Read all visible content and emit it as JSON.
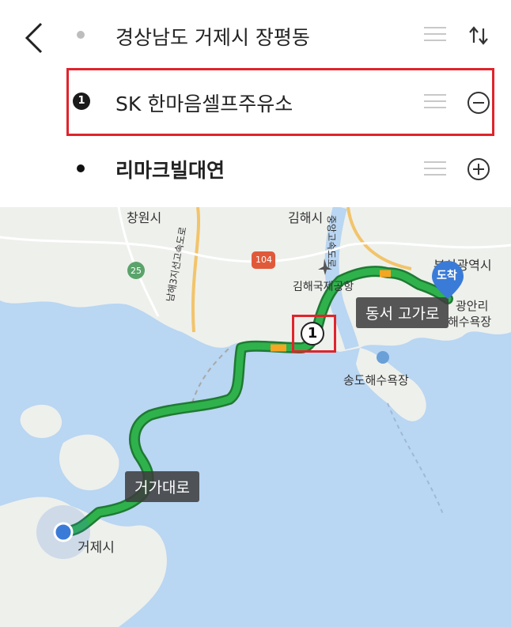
{
  "header": {
    "origin": {
      "label": "경상남도 거제시 장평동"
    },
    "waypoint": {
      "number": "1",
      "label": "SK 한마음셀프주유소"
    },
    "destination": {
      "label": "리마크빌대연"
    }
  },
  "map": {
    "labels": {
      "changwon": "창원시",
      "gimhae": "김해시",
      "busan_station": "부산광역시",
      "gimhae_airport": "김해국제공항",
      "songdo_beach": "송도해수욕장",
      "geoje": "거제시",
      "namhae_expressway": "남해3지선고속도로",
      "expressway_vertical": "중앙고속도로",
      "gwangan": "광안리",
      "haesu": "해수욕장",
      "route_104": "104",
      "route_25": "25"
    },
    "road_callouts": {
      "dongseo": "동서 고가로",
      "geoga": "거가대로"
    },
    "destination_pin": "도착",
    "waypoint_marker": "1"
  },
  "colors": {
    "route": "#2fb24c",
    "route_outline": "#1f7a33",
    "highlight": "#e0242c",
    "sea": "#b9d6f2",
    "land": "#eef0ec",
    "pin": "#3b7bd8"
  },
  "icons": [
    "back-arrow-icon",
    "swap-icon",
    "drag-handle-icon",
    "remove-icon",
    "add-icon",
    "current-location-icon",
    "airport-icon",
    "beach-icon"
  ]
}
